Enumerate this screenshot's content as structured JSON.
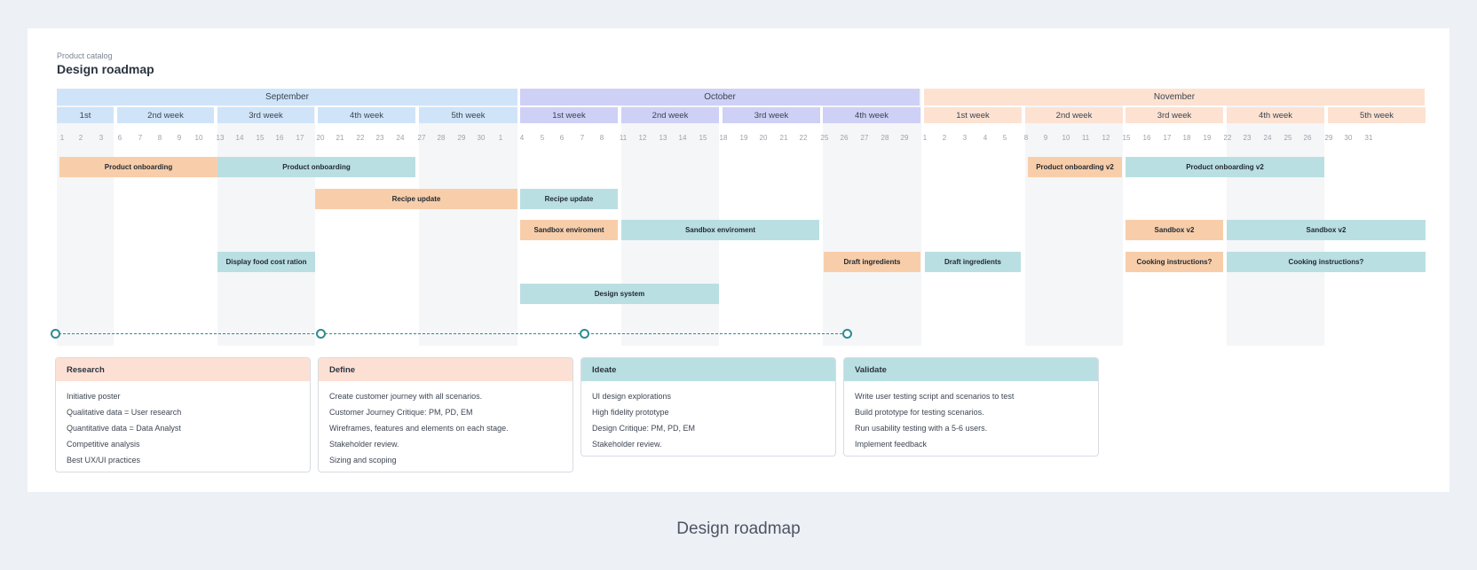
{
  "caption": "Design roadmap",
  "header": {
    "breadcrumb": "Product catalog",
    "title": "Design roadmap"
  },
  "months": [
    {
      "label": "September",
      "color": "#cfe4f8"
    },
    {
      "label": "October",
      "color": "#cfd0f6"
    },
    {
      "label": "November",
      "color": "#fde2d2"
    }
  ],
  "weeks": [
    "1st",
    "2nd week",
    "3rd week",
    "4th week",
    "5th week",
    "1st week",
    "2nd week",
    "3rd week",
    "4th week",
    "1st week",
    "2nd week",
    "3rd week",
    "4th week",
    "5th week"
  ],
  "days": [
    "1",
    "2",
    "3",
    "6",
    "7",
    "8",
    "9",
    "10",
    "13",
    "14",
    "15",
    "16",
    "17",
    "20",
    "21",
    "22",
    "23",
    "24",
    "27",
    "28",
    "29",
    "30",
    "1",
    "4",
    "5",
    "6",
    "7",
    "8",
    "11",
    "12",
    "13",
    "14",
    "15",
    "18",
    "19",
    "20",
    "21",
    "22",
    "25",
    "26",
    "27",
    "28",
    "29",
    "1",
    "2",
    "3",
    "4",
    "5",
    "8",
    "9",
    "10",
    "11",
    "12",
    "15",
    "16",
    "17",
    "18",
    "19",
    "22",
    "23",
    "24",
    "25",
    "26",
    "29",
    "30",
    "31"
  ],
  "tasks": [
    {
      "label": "Product onboarding",
      "color": "orange"
    },
    {
      "label": "Product onboarding",
      "color": "teal"
    },
    {
      "label": "Product onboarding v2",
      "color": "orange"
    },
    {
      "label": "Product onboarding v2",
      "color": "teal"
    },
    {
      "label": "Recipe update",
      "color": "orange"
    },
    {
      "label": "Recipe update",
      "color": "teal"
    },
    {
      "label": "Sandbox enviroment",
      "color": "orange"
    },
    {
      "label": "Sandbox enviroment",
      "color": "teal"
    },
    {
      "label": "Sandbox v2",
      "color": "orange"
    },
    {
      "label": "Sandbox v2",
      "color": "teal"
    },
    {
      "label": "Display food cost ration",
      "color": "teal"
    },
    {
      "label": "Draft ingredients",
      "color": "orange"
    },
    {
      "label": "Draft ingredients",
      "color": "teal"
    },
    {
      "label": "Cooking instructions?",
      "color": "orange"
    },
    {
      "label": "Cooking instructions?",
      "color": "teal"
    },
    {
      "label": "Design system",
      "color": "teal"
    }
  ],
  "phases": [
    {
      "title": "Research",
      "color": "#fde0d4",
      "items": [
        "Initiative poster",
        "Qualitative data = User research",
        "Quantitative data = Data Analyst",
        "Competitive analysis",
        "Best UX/UI practices"
      ]
    },
    {
      "title": "Define",
      "color": "#fde0d4",
      "items": [
        "Create customer journey with all scenarios.",
        "Customer Journey Critique: PM, PD, EM",
        "Wireframes, features and elements on each stage.",
        "Stakeholder review.",
        "Sizing and scoping"
      ]
    },
    {
      "title": "Ideate",
      "color": "#badfe2",
      "items": [
        "UI design explorations",
        "High fidelity prototype",
        "Design Critique: PM, PD, EM",
        "Stakeholder review."
      ]
    },
    {
      "title": "Validate",
      "color": "#badfe2",
      "items": [
        "Write user testing script and scenarios to test",
        "Build prototype for testing scenarios.",
        "Run usability testing with a 5-6 users.",
        "Implement feedback"
      ]
    }
  ]
}
